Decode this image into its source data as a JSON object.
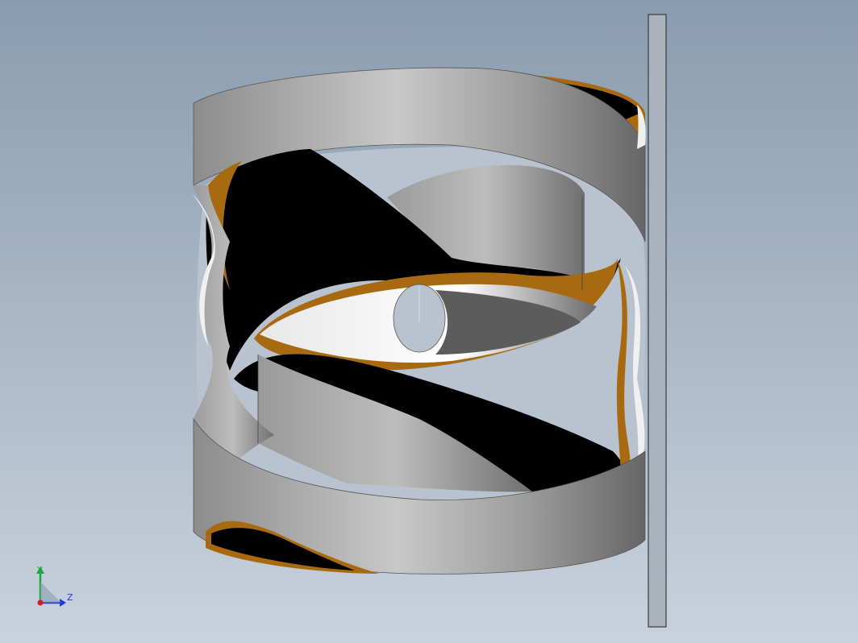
{
  "viewport": {
    "background_top": "#8a9cb0",
    "background_bottom": "#c9d2dc"
  },
  "model": {
    "band_light": "#d9d9d9",
    "band_mid": "#a8a8a8",
    "band_dark": "#6e6e6e",
    "interior_black": "#000000",
    "edge_orange": "#a86a10",
    "inner_white": "#f0f0f0",
    "plate_fill": "#a9b2bd",
    "plate_stroke": "#3b3b3b"
  },
  "triad": {
    "y_label": "Y",
    "z_label": "Z",
    "y_color": "#1aa83a",
    "z_color": "#1f3bd6",
    "origin_color": "#d11f1f"
  }
}
